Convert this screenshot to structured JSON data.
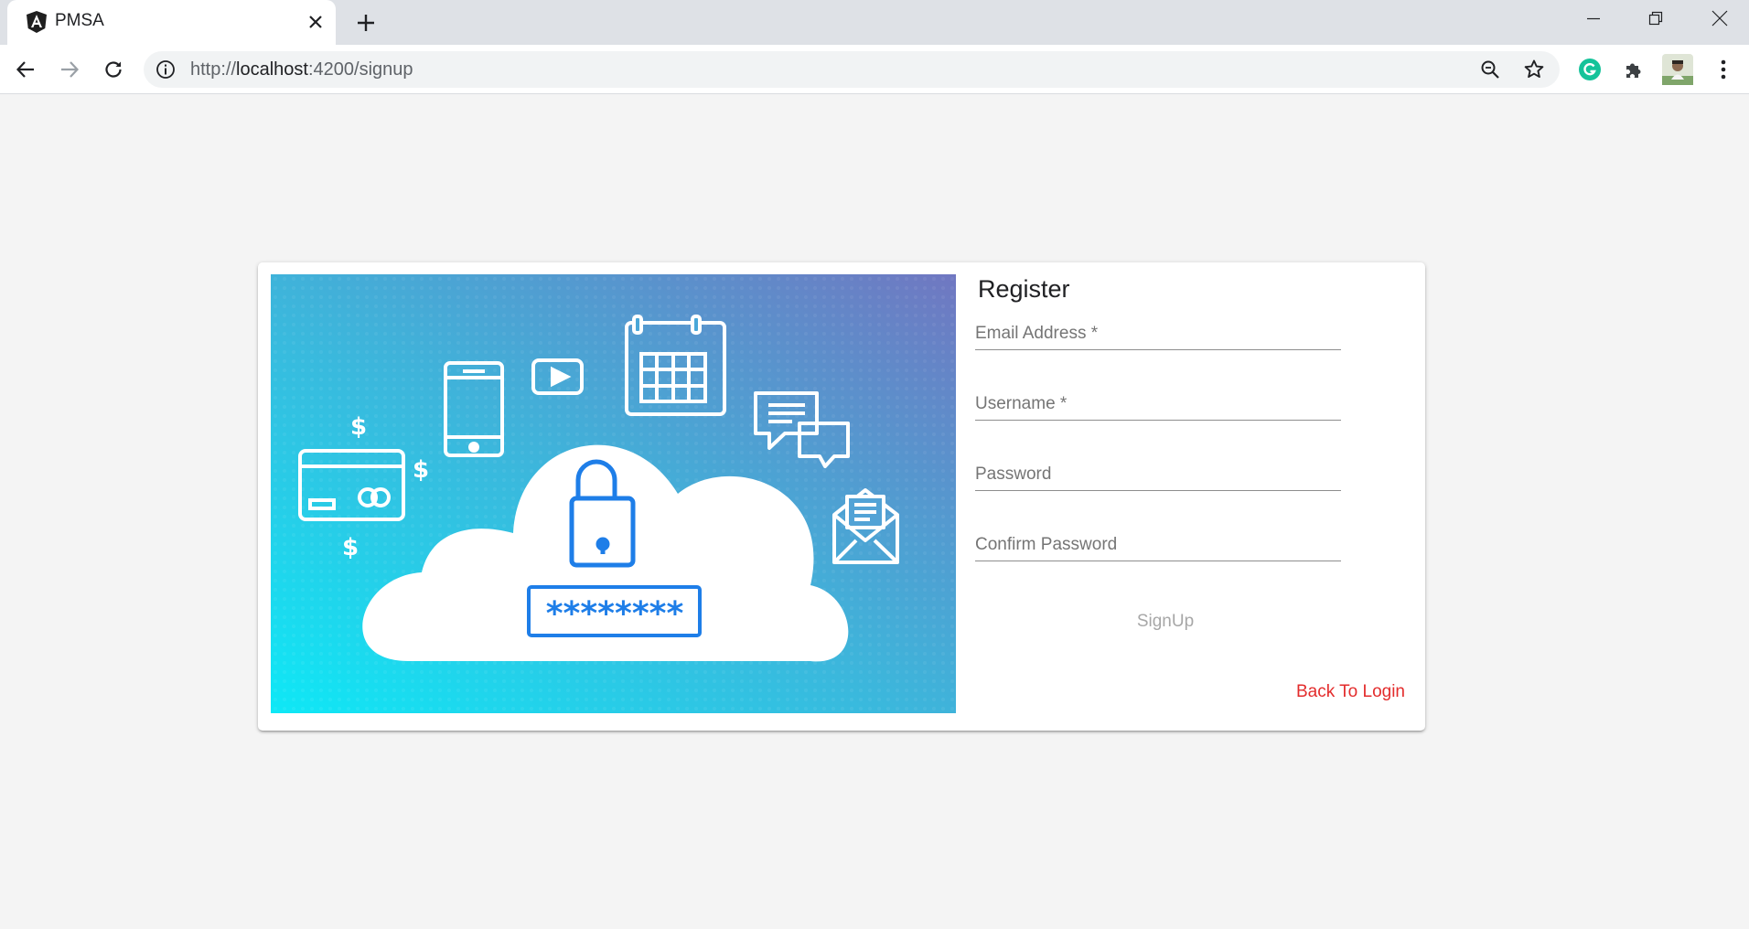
{
  "browser": {
    "tab_title": "PMSA",
    "url_scheme": "http://",
    "url_host": "localhost",
    "url_path": ":4200/signup",
    "icons": [
      "angular-icon",
      "close-icon",
      "plus-icon",
      "minimize-icon",
      "restore-icon",
      "window-close-icon",
      "back-icon",
      "forward-icon",
      "reload-icon",
      "info-icon",
      "zoom-icon",
      "star-icon",
      "grammarly-icon",
      "puzzle-icon",
      "avatar",
      "kebab-menu-icon"
    ]
  },
  "register": {
    "title": "Register",
    "fields": {
      "email_placeholder": "Email Address *",
      "username_placeholder": "Username *",
      "password_placeholder": "Password",
      "confirm_placeholder": "Confirm Password"
    },
    "signup_label": "SignUp",
    "back_to_login_label": "Back To Login"
  },
  "illustration": {
    "password_mask": "********",
    "currency_symbol": "$"
  },
  "colors": {
    "accent_link": "#e32c2c",
    "disabled_button": "#a7a7a7",
    "hero_gradient_start": "#0ee8f6",
    "hero_gradient_end": "#7077c1",
    "icon_blue": "#1e7ee8"
  }
}
